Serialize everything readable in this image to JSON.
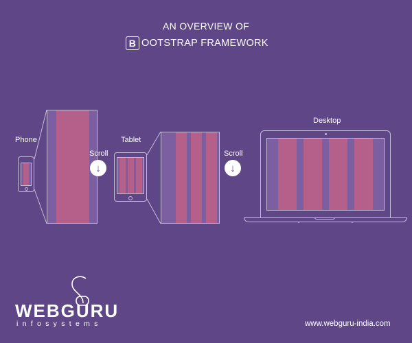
{
  "title": {
    "line1": "AN OVERVIEW OF",
    "b_letter": "B",
    "line2_rest": "OOTSTRAP FRAMEWORK"
  },
  "devices": {
    "phone": {
      "label": "Phone"
    },
    "tablet": {
      "label": "Tablet"
    },
    "desktop": {
      "label": "Desktop"
    }
  },
  "scroll_label": "Scroll",
  "scroll_arrow": "↓",
  "footer": {
    "logo": "WEBGURU",
    "logo_sub": "infosystems",
    "url": "www.webguru-india.com"
  },
  "colors": {
    "background": "#5f4687",
    "column": "#b5608a",
    "gutter": "#7c5fa0",
    "frame": "#c7bcd8"
  }
}
